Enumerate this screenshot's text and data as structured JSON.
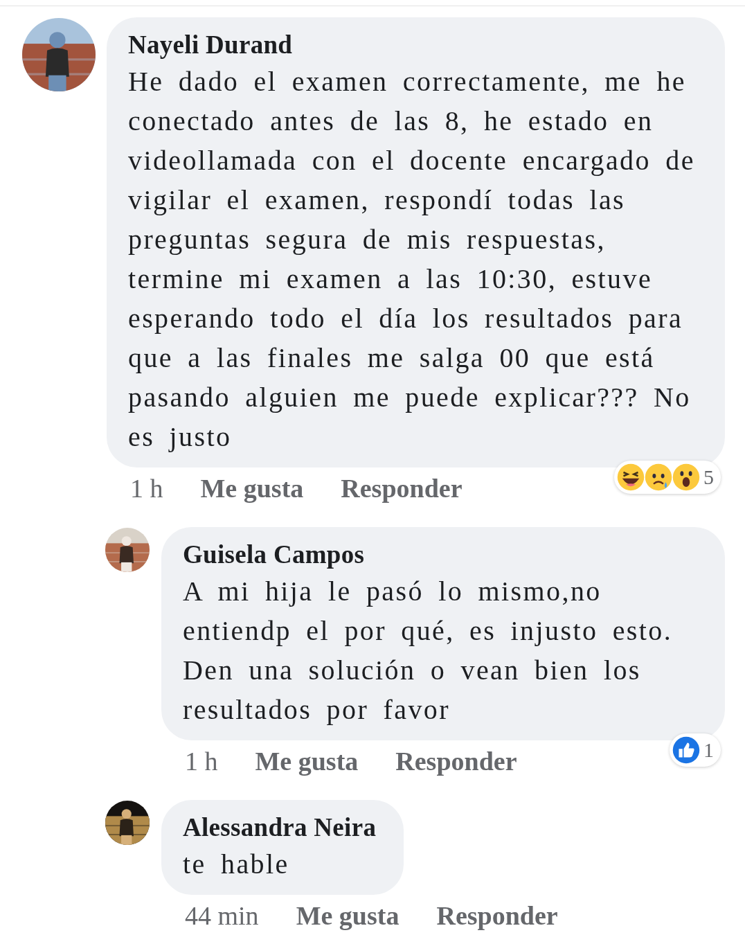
{
  "comments": [
    {
      "author": "Nayeli Durand",
      "text": "He dado el examen correctamente, me he conectado antes de las 8, he estado en videollamada con el docente encargado de vigilar el examen, respondí todas las preguntas segura de mis respuestas, termine mi examen a las 10:30, estuve esperando todo el día los resultados para que a las finales me salga 00 que está pasando alguien me puede explicar??? No es justo",
      "time": "1 h",
      "like_label": "Me gusta",
      "reply_label": "Responder",
      "reactions": {
        "icons": [
          {
            "kind": "haha"
          },
          {
            "kind": "sad"
          },
          {
            "kind": "wow"
          }
        ],
        "count": "5"
      },
      "children": [
        {
          "author": "Guisela Campos",
          "text": "A mi hija le pasó lo mismo,no entiendp el por qué, es injusto esto. Den una solución o vean bien los resultados por favor",
          "time": "1 h",
          "like_label": "Me gusta",
          "reply_label": "Responder",
          "reactions": {
            "icons": [
              {
                "kind": "like"
              }
            ],
            "count": "1"
          }
        },
        {
          "author": "Alessandra Neira",
          "text": "te hable",
          "time": "44 min",
          "like_label": "Me gusta",
          "reply_label": "Responder"
        }
      ]
    }
  ]
}
